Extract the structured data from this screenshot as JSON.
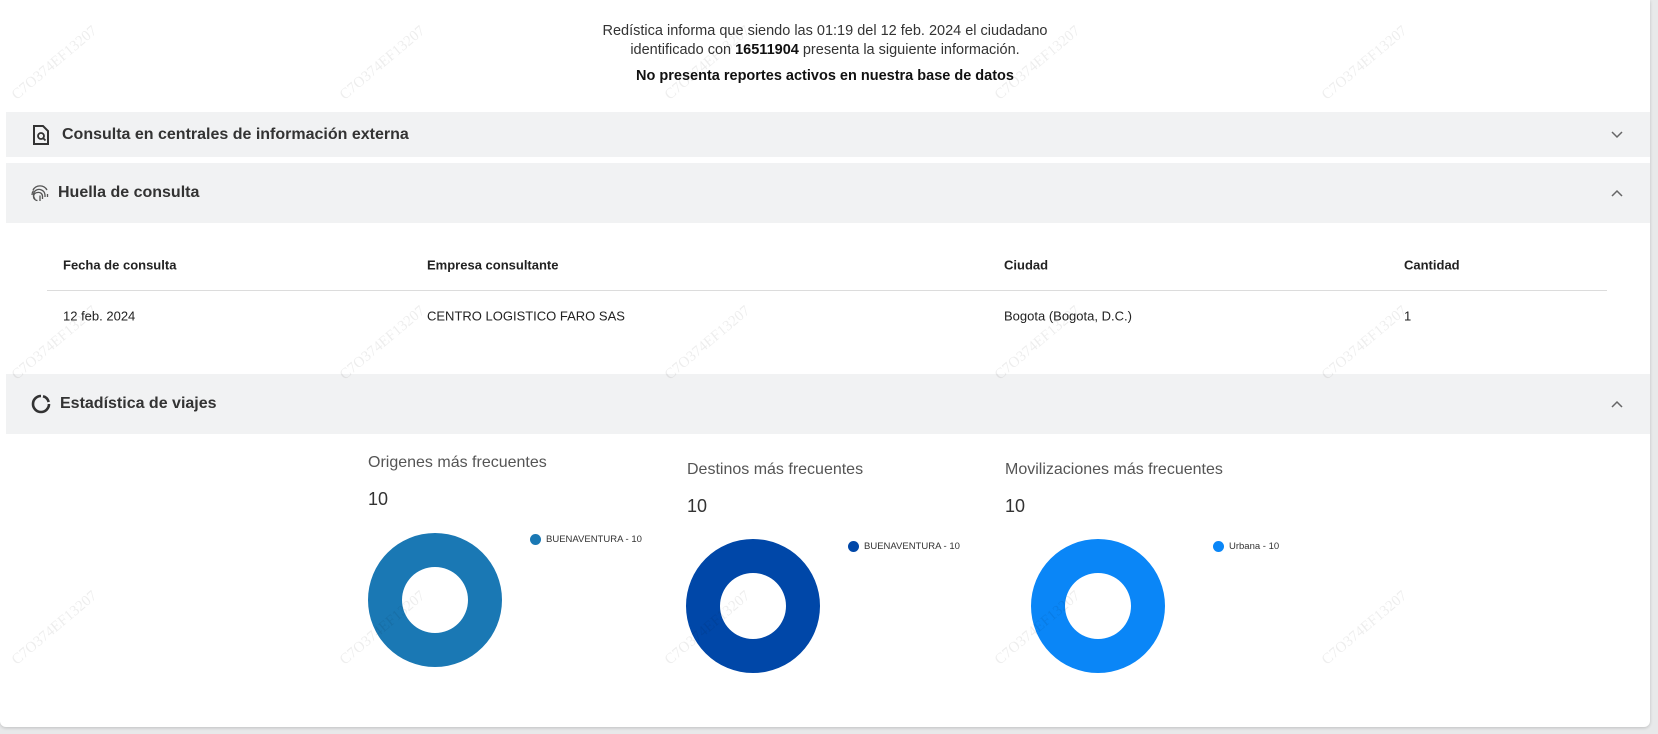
{
  "intro": {
    "line1": "Redística informa que siendo las 01:19 del 12 feb. 2024 el ciudadano",
    "line2_pre": "identificado con ",
    "id_number": "16511904",
    "line2_post": " presenta la siguiente información.",
    "status": "No presenta reportes activos en nuestra base de datos"
  },
  "sections": {
    "externa": {
      "title": "Consulta en centrales de información externa",
      "icon": "document-search-icon",
      "expanded": false
    },
    "huella": {
      "title": "Huella de consulta",
      "icon": "fingerprint-icon",
      "expanded": true
    },
    "estadistica": {
      "title": "Estadística de viajes",
      "icon": "donut-chart-icon",
      "expanded": true
    }
  },
  "table": {
    "headers": [
      "Fecha de consulta",
      "Empresa consultante",
      "Ciudad",
      "Cantidad"
    ],
    "rows": [
      [
        "12 feb. 2024",
        "CENTRO LOGISTICO FARO SAS",
        "Bogota (Bogota, D.C.)",
        "1"
      ]
    ]
  },
  "watermark": "C7O374EF13207",
  "chart_data": [
    {
      "type": "pie",
      "title": "Origenes más frecuentes",
      "total": "10",
      "categories": [
        "BUENAVENTURA"
      ],
      "values": [
        10
      ],
      "legend_labels": [
        "BUENAVENTURA - 10"
      ],
      "colors": [
        "#1a78b4"
      ]
    },
    {
      "type": "pie",
      "title": "Destinos más frecuentes",
      "total": "10",
      "categories": [
        "BUENAVENTURA"
      ],
      "values": [
        10
      ],
      "legend_labels": [
        "BUENAVENTURA - 10"
      ],
      "colors": [
        "#0047a8"
      ]
    },
    {
      "type": "pie",
      "title": "Movilizaciones más frecuentes",
      "total": "10",
      "categories": [
        "Urbana"
      ],
      "values": [
        10
      ],
      "legend_labels": [
        "Urbana - 10"
      ],
      "colors": [
        "#0a86f7"
      ]
    }
  ]
}
